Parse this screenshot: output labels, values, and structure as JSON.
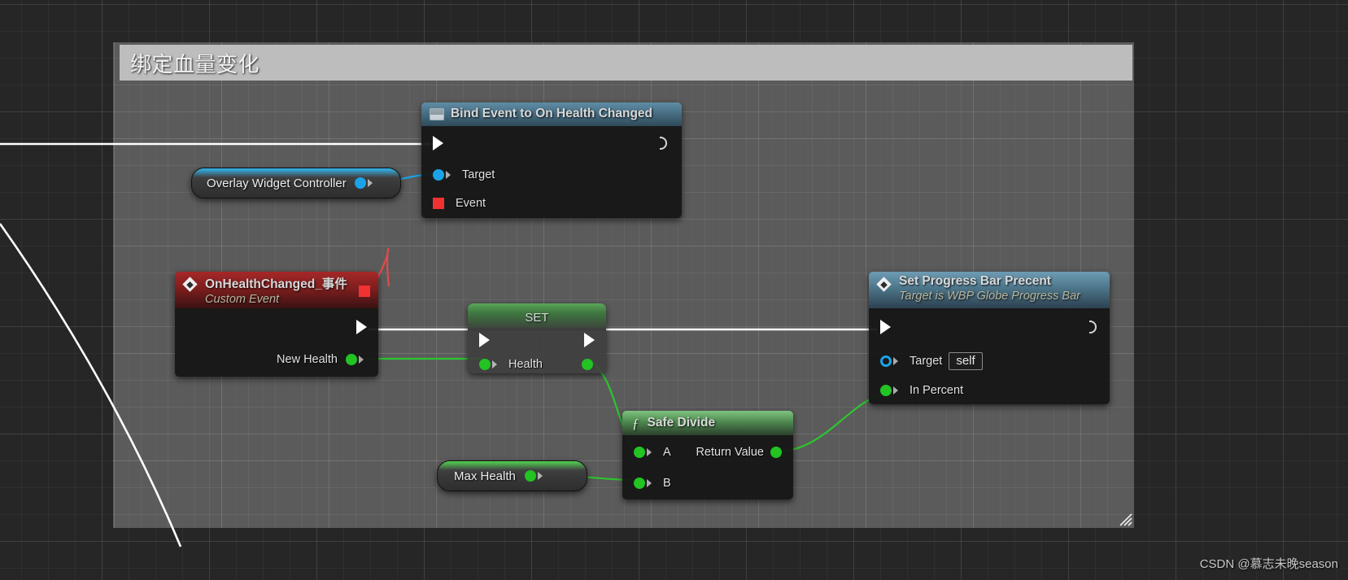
{
  "app": {
    "kind": "unreal-blueprint-graph",
    "watermark": "CSDN @慕志未晚season"
  },
  "comment": {
    "title": "绑定血量变化",
    "resize_handle_name": "comment-resize-handle"
  },
  "colors": {
    "exec_white": "#FFFFFF",
    "object_blue": "#1AA3E8",
    "delegate_red": "#F23232",
    "float_green": "#22C322",
    "header_function_blue": "#4E7F99",
    "header_event_red": "#9E2020",
    "header_variable_green": "#3F8C3F",
    "comment_bg": "#7D7D7D",
    "comment_header": "#BDBDBD"
  },
  "nodes": {
    "bind_event": {
      "title": "Bind Event to On Health Changed",
      "icon": "bind-event-icon",
      "exec_in": "",
      "exec_out": "",
      "pins": [
        {
          "label": "Target",
          "type": "object"
        },
        {
          "label": "Event",
          "type": "delegate"
        }
      ]
    },
    "overlay_widget_controller": {
      "title": "Overlay Widget Controller",
      "pin_type": "object"
    },
    "custom_event": {
      "title": "OnHealthChanged_事件",
      "subtitle": "Custom Event",
      "icon": "event-diamond-icon",
      "outputs": [
        {
          "label": "New Health",
          "type": "float"
        }
      ]
    },
    "set_node": {
      "title": "SET",
      "pins": [
        {
          "label": "Health",
          "type": "float"
        }
      ]
    },
    "max_health": {
      "title": "Max Health",
      "pin_type": "float"
    },
    "safe_divide": {
      "title": "Safe Divide",
      "icon": "function-f-icon",
      "inputs": [
        {
          "label": "A",
          "type": "float"
        },
        {
          "label": "B",
          "type": "float"
        }
      ],
      "outputs": [
        {
          "label": "Return Value",
          "type": "float"
        }
      ]
    },
    "set_progress_bar": {
      "title": "Set Progress Bar Precent",
      "subtitle": "Target is WBP Globe Progress Bar",
      "icon": "function-diamond-icon",
      "pins": [
        {
          "label": "Target",
          "type": "object-ref",
          "value": "self"
        },
        {
          "label": "In Percent",
          "type": "float"
        }
      ]
    }
  }
}
